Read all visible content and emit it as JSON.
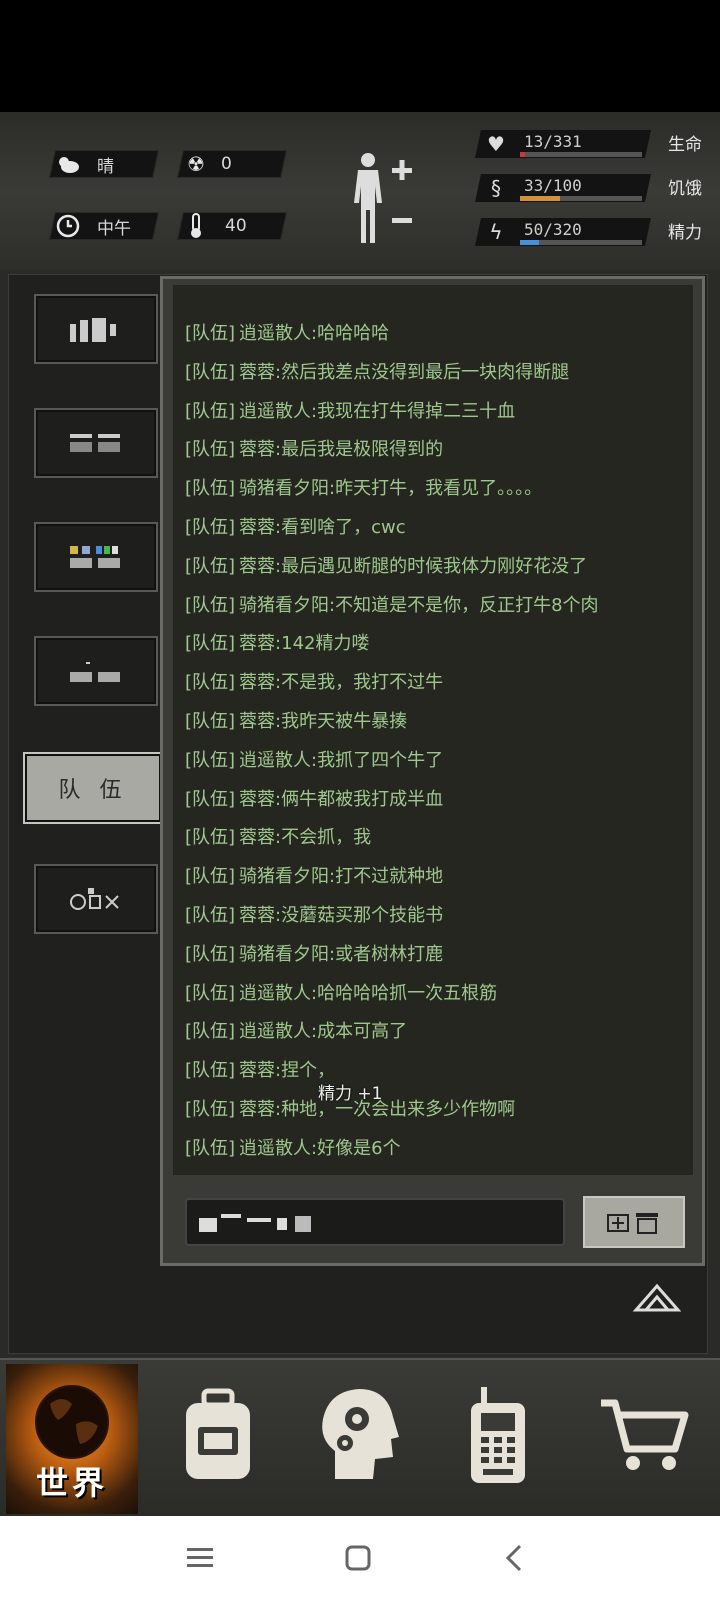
{
  "hud": {
    "weather": "晴",
    "radiation": "0",
    "time_of_day": "中午",
    "temperature": "40"
  },
  "stats": [
    {
      "value": "13/331",
      "label": "生命",
      "fraction": 0.039,
      "color": "#c83a3a",
      "icon": "heart-icon"
    },
    {
      "value": "33/100",
      "label": "饥饿",
      "fraction": 0.33,
      "color": "#d4903a",
      "icon": "stomach-icon"
    },
    {
      "value": "50/320",
      "label": "精力",
      "fraction": 0.156,
      "color": "#4a90d4",
      "icon": "energy-icon"
    }
  ],
  "tabs": {
    "active_label": "队 伍"
  },
  "chat": {
    "messages": [
      {
        "channel": "[队伍]",
        "text": "逍遥散人:哈哈哈哈"
      },
      {
        "channel": "[队伍]",
        "text": "蓉蓉:然后我差点没得到最后一块肉得断腿"
      },
      {
        "channel": "[队伍]",
        "text": "逍遥散人:我现在打牛得掉二三十血"
      },
      {
        "channel": "[队伍]",
        "text": "蓉蓉:最后我是极限得到的"
      },
      {
        "channel": "[队伍]",
        "text": "骑猪看夕阳:昨天打牛，我看见了。。。。"
      },
      {
        "channel": "[队伍]",
        "text": "蓉蓉:看到啥了，cwc"
      },
      {
        "channel": "[队伍]",
        "text": "蓉蓉:最后遇见断腿的时候我体力刚好花没了"
      },
      {
        "channel": "[队伍]",
        "text": "骑猪看夕阳:不知道是不是你，反正打牛8个肉"
      },
      {
        "channel": "[队伍]",
        "text": "蓉蓉:142精力喽"
      },
      {
        "channel": "[队伍]",
        "text": "蓉蓉:不是我，我打不过牛"
      },
      {
        "channel": "[队伍]",
        "text": "蓉蓉:我昨天被牛暴揍"
      },
      {
        "channel": "[队伍]",
        "text": "逍遥散人:我抓了四个牛了"
      },
      {
        "channel": "[队伍]",
        "text": "蓉蓉:俩牛都被我打成半血"
      },
      {
        "channel": "[队伍]",
        "text": "蓉蓉:不会抓，我"
      },
      {
        "channel": "[队伍]",
        "text": "骑猪看夕阳:打不过就种地"
      },
      {
        "channel": "[队伍]",
        "text": "蓉蓉:没蘑菇买那个技能书"
      },
      {
        "channel": "[队伍]",
        "text": "骑猪看夕阳:或者树林打鹿"
      },
      {
        "channel": "[队伍]",
        "text": "逍遥散人:哈哈哈哈抓一次五根筋"
      },
      {
        "channel": "[队伍]",
        "text": "逍遥散人:成本可高了"
      },
      {
        "channel": "[队伍]",
        "text": "蓉蓉:捏个，"
      },
      {
        "channel": "[队伍]",
        "text": "蓉蓉:种地，一次会出来多少作物啊"
      },
      {
        "channel": "[队伍]",
        "text": "逍遥散人:好像是6个"
      }
    ],
    "float_notice": "精力 +1"
  },
  "nav": {
    "world_label": "世界"
  }
}
